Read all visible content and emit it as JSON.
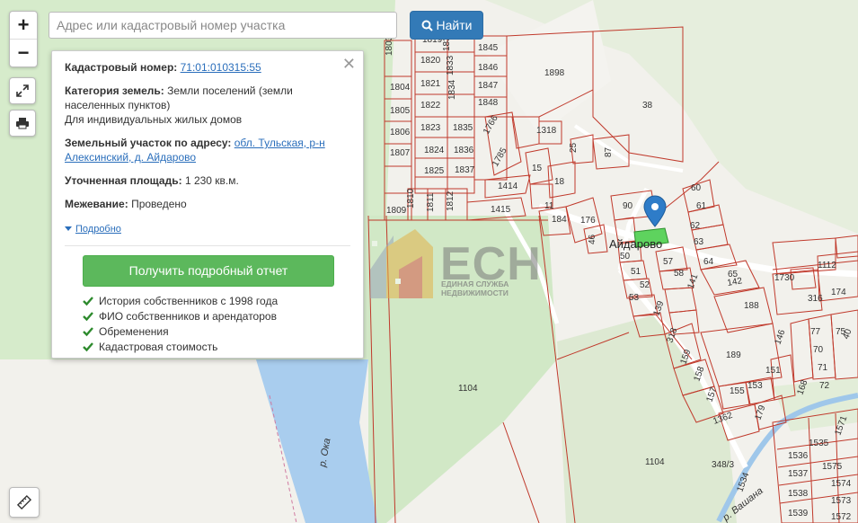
{
  "search": {
    "placeholder": "Адрес или кадастровый номер участка",
    "button_label": "Найти"
  },
  "zoom": {
    "in_label": "+",
    "out_label": "−"
  },
  "popup": {
    "cadastral_label": "Кадастровый номер:",
    "cadastral_value": "71:01:010315:55",
    "category_label": "Категория земель:",
    "category_value": "Земли поселений (земли населенных пунктов)",
    "category_use": "Для индивидуальных жилых домов",
    "address_label": "Земельный участок по адресу:",
    "address_value": "обл. Тульская, р-н Алексинский, д. Айдарово",
    "area_label": "Уточненная площадь:",
    "area_value": "1 230 кв.м.",
    "survey_label": "Межевание:",
    "survey_value": "Проведено",
    "details_link": "Подробно",
    "report_button": "Получить подробный отчет",
    "features": [
      "История собственников с 1998 года",
      "ФИО собственников и арендаторов",
      "Обременения",
      "Кадастровая стоимость"
    ]
  },
  "watermark": {
    "logo_text": "ЕСН",
    "line1": "ЕДИНАЯ СЛУЖБА",
    "line2": "НЕДВИЖИМОСТИ"
  },
  "map": {
    "place_label": "Айдарово",
    "river_label": "р. Ока",
    "stream_label": "р. Вашана",
    "plot_numbers": [
      "1819",
      "1832",
      "1845",
      "1803",
      "1820",
      "1833",
      "1846",
      "1804",
      "1821",
      "1834",
      "1847",
      "1805",
      "1822",
      "1848",
      "1806",
      "1823",
      "1835",
      "1766",
      "1807",
      "1824",
      "1836",
      "1825",
      "1837",
      "1809",
      "1810",
      "1811",
      "1812",
      "1414",
      "1415",
      "1898",
      "38",
      "1318",
      "25",
      "87",
      "1785",
      "15",
      "18",
      "11",
      "184",
      "176",
      "46",
      "90",
      "60",
      "61",
      "62",
      "63",
      "64",
      "65",
      "50",
      "51",
      "52",
      "53",
      "57",
      "58",
      "139",
      "141",
      "142",
      "188",
      "318",
      "159",
      "158",
      "157",
      "155",
      "153",
      "151",
      "179",
      "189",
      "1104",
      "1104",
      "1362",
      "1730",
      "1112",
      "174",
      "316",
      "146",
      "77",
      "75",
      "40",
      "70",
      "71",
      "72",
      "168",
      "1535",
      "1536",
      "1537",
      "1538",
      "1539",
      "1575",
      "1574",
      "1573",
      "1572",
      "1571",
      "1534",
      "348/3",
      "11"
    ],
    "colors": {
      "road": "#fbfbfa",
      "forest": "#d1e8c6",
      "water": "#aed1f0",
      "plot_line": "#c0392b",
      "selected_plot": "#5ed35e",
      "marker": "#2e7cc8"
    }
  },
  "icons": {
    "fullscreen": "expand-icon",
    "print": "print-icon",
    "ruler": "ruler-icon",
    "search": "search-icon",
    "check": "check-icon",
    "close": "close-icon",
    "marker": "map-marker-icon"
  }
}
